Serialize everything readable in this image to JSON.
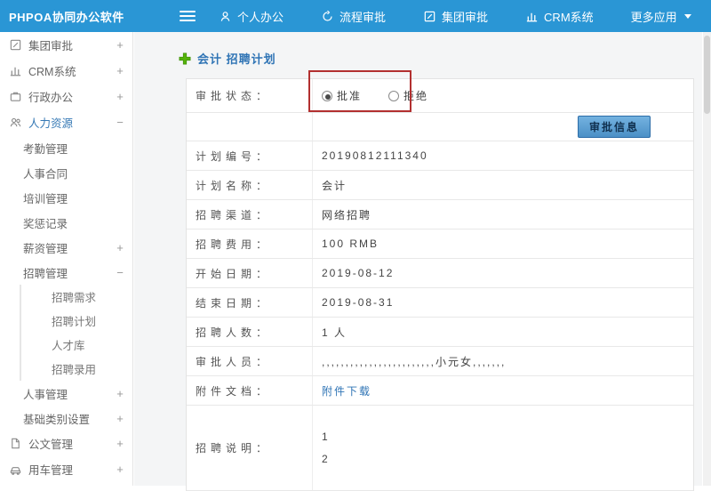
{
  "topbar": {
    "brand": "PHPOA协同办公软件",
    "items": [
      {
        "label": "个人办公",
        "icon": "person-icon"
      },
      {
        "label": "流程审批",
        "icon": "process-icon"
      },
      {
        "label": "集团审批",
        "icon": "edit-icon"
      },
      {
        "label": "CRM系统",
        "icon": "chart-icon"
      },
      {
        "label": "更多应用",
        "icon": "caret-down-icon"
      }
    ]
  },
  "sidebar": {
    "items": [
      {
        "label": "集团审批",
        "expander": "+",
        "icon": "edit-icon"
      },
      {
        "label": "CRM系统",
        "expander": "+",
        "icon": "chart-icon"
      },
      {
        "label": "行政办公",
        "expander": "+",
        "icon": "briefcase-icon"
      },
      {
        "label": "人力资源",
        "expander": "−",
        "icon": "people-icon",
        "active": true
      },
      {
        "label": "考勤管理",
        "expander": ""
      },
      {
        "label": "人事合同",
        "expander": ""
      },
      {
        "label": "培训管理",
        "expander": ""
      },
      {
        "label": "奖惩记录",
        "expander": ""
      },
      {
        "label": "薪资管理",
        "expander": "+"
      },
      {
        "label": "招聘管理",
        "expander": "−"
      },
      {
        "label": "招聘需求",
        "expander": ""
      },
      {
        "label": "招聘计划",
        "expander": ""
      },
      {
        "label": "人才库",
        "expander": ""
      },
      {
        "label": "招聘录用",
        "expander": ""
      },
      {
        "label": "人事管理",
        "expander": "+"
      },
      {
        "label": "基础类别设置",
        "expander": "+"
      },
      {
        "label": "公文管理",
        "expander": "+",
        "icon": "document-icon"
      },
      {
        "label": "用车管理",
        "expander": "+",
        "icon": "car-icon"
      }
    ]
  },
  "main": {
    "title": "会计 招聘计划"
  },
  "approval": {
    "label": "审批状态：",
    "options": [
      {
        "label": "批准",
        "selected": true
      },
      {
        "label": "拒绝",
        "selected": false
      }
    ],
    "button_label": "审批信息"
  },
  "form": {
    "rows": [
      {
        "label": "计划编号：",
        "value": "20190812111340"
      },
      {
        "label": "计划名称：",
        "value": "会计"
      },
      {
        "label": "招聘渠道：",
        "value": "网络招聘"
      },
      {
        "label": "招聘费用：",
        "value": "100 RMB"
      },
      {
        "label": "开始日期：",
        "value": "2019-08-12"
      },
      {
        "label": "结束日期：",
        "value": "2019-08-31"
      },
      {
        "label": "招聘人数：",
        "value": "1 人"
      },
      {
        "label": "审批人员：",
        "value": ",,,,,,,,,,,,,,,,,,,,,,,,小元女,,,,,,,"
      },
      {
        "label": "附件文档：",
        "value": "附件下载"
      }
    ],
    "description": {
      "label": "招聘说明：",
      "line1": "1",
      "line2": "2"
    }
  },
  "colors": {
    "topbar": "#2a96d5",
    "accent_blue": "#2f74b5",
    "annotation_red": "#b23030",
    "plus_green": "#55b30a"
  }
}
